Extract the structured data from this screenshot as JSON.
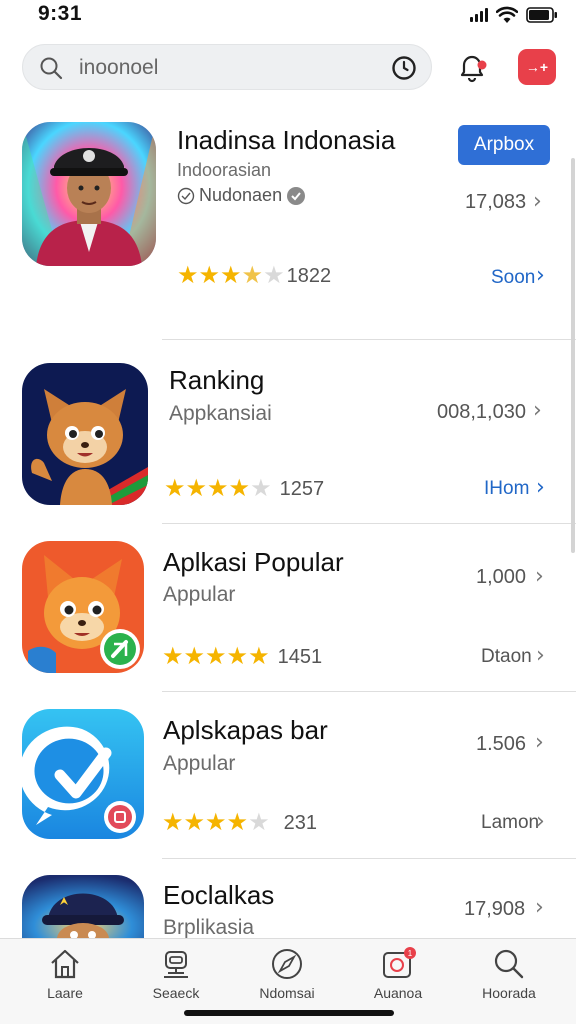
{
  "status_bar": {
    "time": "9:31"
  },
  "search": {
    "text": "inoonoel"
  },
  "header": {
    "red_button_label": "→+"
  },
  "apps": [
    {
      "name": "Inadinsa Indonasia",
      "category": "Indoorasian",
      "developer": "Nudonaen",
      "get_button": "Arpbox",
      "count": "17,083",
      "rating_count": "1822",
      "link": "Soon"
    },
    {
      "name": "Ranking",
      "category": "Appkansiai",
      "count": "008,1,030",
      "rating_count": "1257",
      "link": "IHom"
    },
    {
      "name": "Aplkasi Popular",
      "category": "Appular",
      "count": "1,000",
      "rating_count": "1451",
      "link": "Dtaon"
    },
    {
      "name": "Aplskapas bar",
      "category": "Appular",
      "count": "1.506",
      "rating_count": "231",
      "link": "Lamon"
    },
    {
      "name": "Eoclalkas",
      "category": "Brplikasia",
      "count": "17,908"
    }
  ],
  "tabs": [
    {
      "label": "Laare",
      "icon": "home-icon"
    },
    {
      "label": "Seaeck",
      "icon": "robot-icon"
    },
    {
      "label": "Ndomsai",
      "icon": "compass-icon"
    },
    {
      "label": "Auanoa",
      "icon": "arcade-icon"
    },
    {
      "label": "Hoorada",
      "icon": "search-icon"
    }
  ],
  "colors": {
    "accent_blue": "#2f6fd6",
    "link_blue": "#2167c7",
    "star_gold": "#f5b400",
    "badge_red": "#e8404a"
  }
}
